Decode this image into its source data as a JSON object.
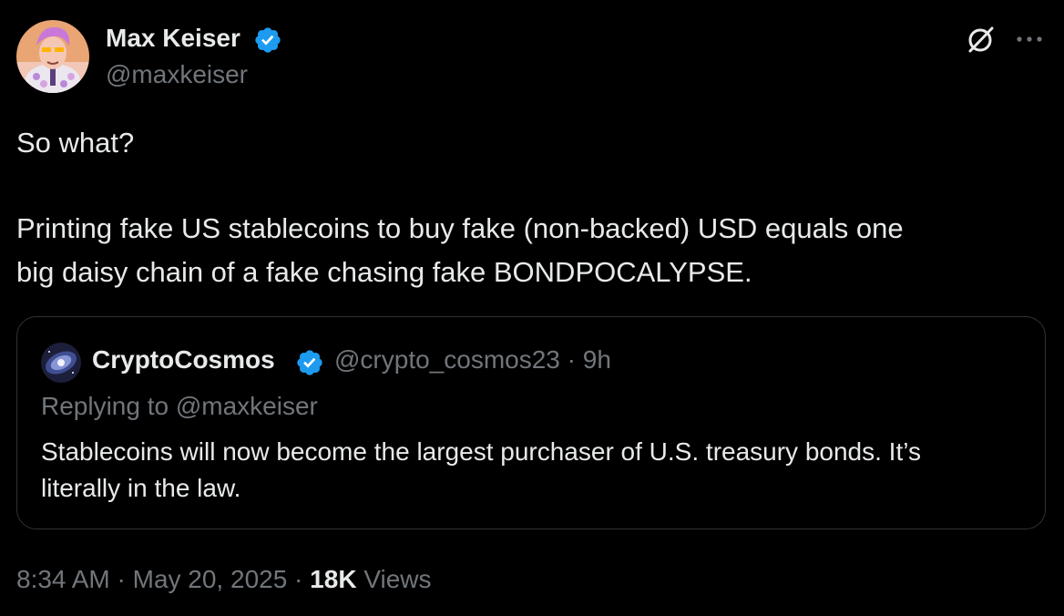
{
  "author": {
    "display_name": "Max Keiser",
    "handle": "@maxkeiser",
    "verified": true,
    "verified_color": "#1d9bf0"
  },
  "tweet": {
    "line1": "So what?",
    "line2": "Printing fake US stablecoins to buy fake (non-backed) USD equals one",
    "line3": "big daisy chain of a fake chasing fake BONDPOCALYPSE."
  },
  "quoted": {
    "display_name": "CryptoCosmos",
    "meta": "@crypto_cosmos23 · 9h",
    "replying_to": "Replying to @maxkeiser",
    "line1": "Stablecoins will now become the largest purchaser of U.S. treasury bonds. It’s",
    "line2": "literally in the law."
  },
  "footer": {
    "timestamp": "8:34 AM · May 20, 2025 · ",
    "views_count": "18K",
    "views_label": " Views"
  },
  "icons": {
    "grok": "grok-icon",
    "more": "more-icon",
    "verified": "verified-badge-icon"
  },
  "colors": {
    "background": "#000000",
    "text": "#e7e9ea",
    "secondary": "#71767b",
    "border": "#2f3336"
  }
}
